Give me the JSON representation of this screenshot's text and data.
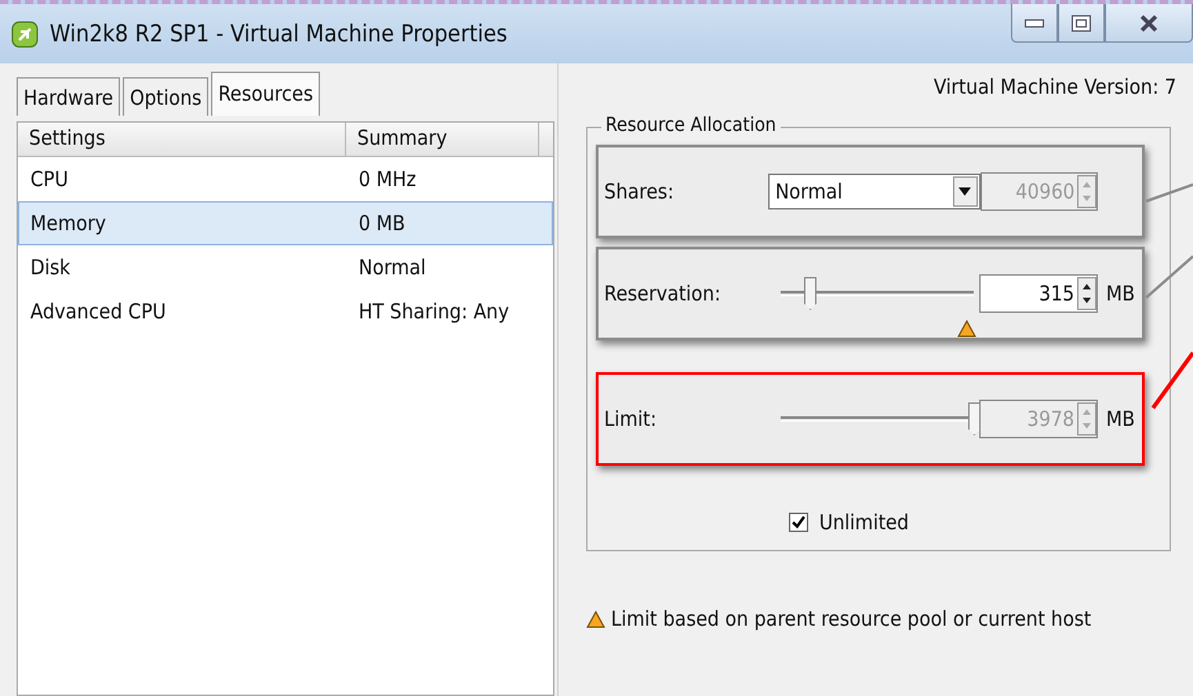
{
  "window": {
    "title": "Win2k8 R2 SP1 - Virtual Machine Properties"
  },
  "tabs": [
    {
      "label": "Hardware",
      "selected": false
    },
    {
      "label": "Options",
      "selected": false
    },
    {
      "label": "Resources",
      "selected": true
    }
  ],
  "version": "Virtual Machine Version: 7",
  "table": {
    "columns": [
      "Settings",
      "Summary"
    ],
    "rows": [
      {
        "setting": "CPU",
        "summary": "0 MHz",
        "selected": false
      },
      {
        "setting": "Memory",
        "summary": "0 MB",
        "selected": true
      },
      {
        "setting": "Disk",
        "summary": "Normal",
        "selected": false
      },
      {
        "setting": "Advanced CPU",
        "summary": "HT Sharing: Any",
        "selected": false
      }
    ]
  },
  "allocation": {
    "title": "Resource Allocation",
    "rows": [
      {
        "kind": "dropdown",
        "label": "Shares:",
        "value": "Normal",
        "number": "40960",
        "number_disabled": true,
        "color": "#8c8c8c"
      },
      {
        "kind": "slider",
        "label": "Reservation:",
        "level": 0.15,
        "number": "315",
        "number_disabled": false,
        "unit": "MB",
        "marker": true,
        "color": "#8c8c8c"
      },
      {
        "kind": "slider",
        "label": "Limit:",
        "level": 1.0,
        "number": "3978",
        "number_disabled": true,
        "unit": "MB",
        "marker": false,
        "color": "#ff0000"
      }
    ],
    "unlimited": {
      "label": "Unlimited",
      "checked": true
    }
  },
  "note": "Limit based on parent resource pool or current host"
}
